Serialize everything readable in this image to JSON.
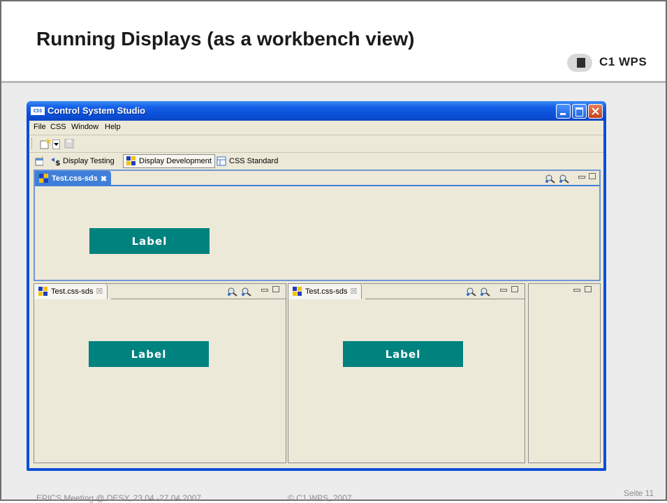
{
  "slide": {
    "title": "Running Displays (as a workbench view)",
    "logo_text": "C1 WPS",
    "footer_left": "EPICS Meeting @ DESY, 23.04.-27.04.2007",
    "footer_center": "© C1 WPS, 2007",
    "footer_right": "Seite 11"
  },
  "window": {
    "icon_text": "CSS",
    "title": "Control System Studio",
    "menu": [
      "File",
      "CSS",
      "Window",
      "Help"
    ],
    "perspectives": [
      {
        "label": "Display Testing",
        "active": false
      },
      {
        "label": "Display Development",
        "active": true
      },
      {
        "label": "CSS Standard",
        "active": false
      }
    ]
  },
  "views": [
    {
      "tab_label": "Test.css-sds",
      "widget_label": "Label",
      "active": true
    },
    {
      "tab_label": "Test.css-sds",
      "widget_label": "Label",
      "active": false
    },
    {
      "tab_label": "Test.css-sds",
      "widget_label": "Label",
      "active": false
    }
  ],
  "colors": {
    "title_bar": "#0a4fd8",
    "active_tab": "#3f7fd9",
    "label_widget": "#00827f",
    "panel_bg": "#ece9d8"
  },
  "icons": [
    "app-css-icon",
    "new-wizard-icon",
    "save-icon",
    "perspective-icon",
    "display-icon",
    "zoom-in-icon",
    "zoom-out-icon",
    "minimize-icon",
    "maximize-icon",
    "close-icon"
  ]
}
